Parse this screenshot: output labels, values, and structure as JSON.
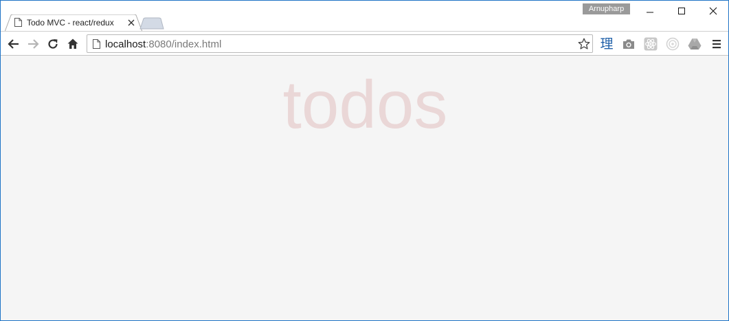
{
  "window": {
    "profile_name": "Arnupharp",
    "border_color": "#1e73c6"
  },
  "tabs": [
    {
      "title": "Todo MVC - react/redux",
      "icon": "page-icon",
      "active": true
    }
  ],
  "toolbar": {
    "url_host": "localhost",
    "url_rest": ":8080/index.html",
    "icons": [
      "back-arrow-icon",
      "forward-arrow-icon",
      "reload-icon",
      "home-icon",
      "bookmark-star-icon"
    ],
    "extensions": [
      {
        "name": "dictionary-extension-icon",
        "glyph": "理"
      },
      {
        "name": "camera-extension-icon"
      },
      {
        "name": "react-devtools-icon"
      },
      {
        "name": "disabled-extension-icon"
      },
      {
        "name": "google-drive-icon"
      },
      {
        "name": "chrome-menu-icon"
      }
    ]
  },
  "page": {
    "heading": "todos",
    "heading_color": "rgba(175,47,47,0.15)",
    "background": "#f5f5f5"
  }
}
